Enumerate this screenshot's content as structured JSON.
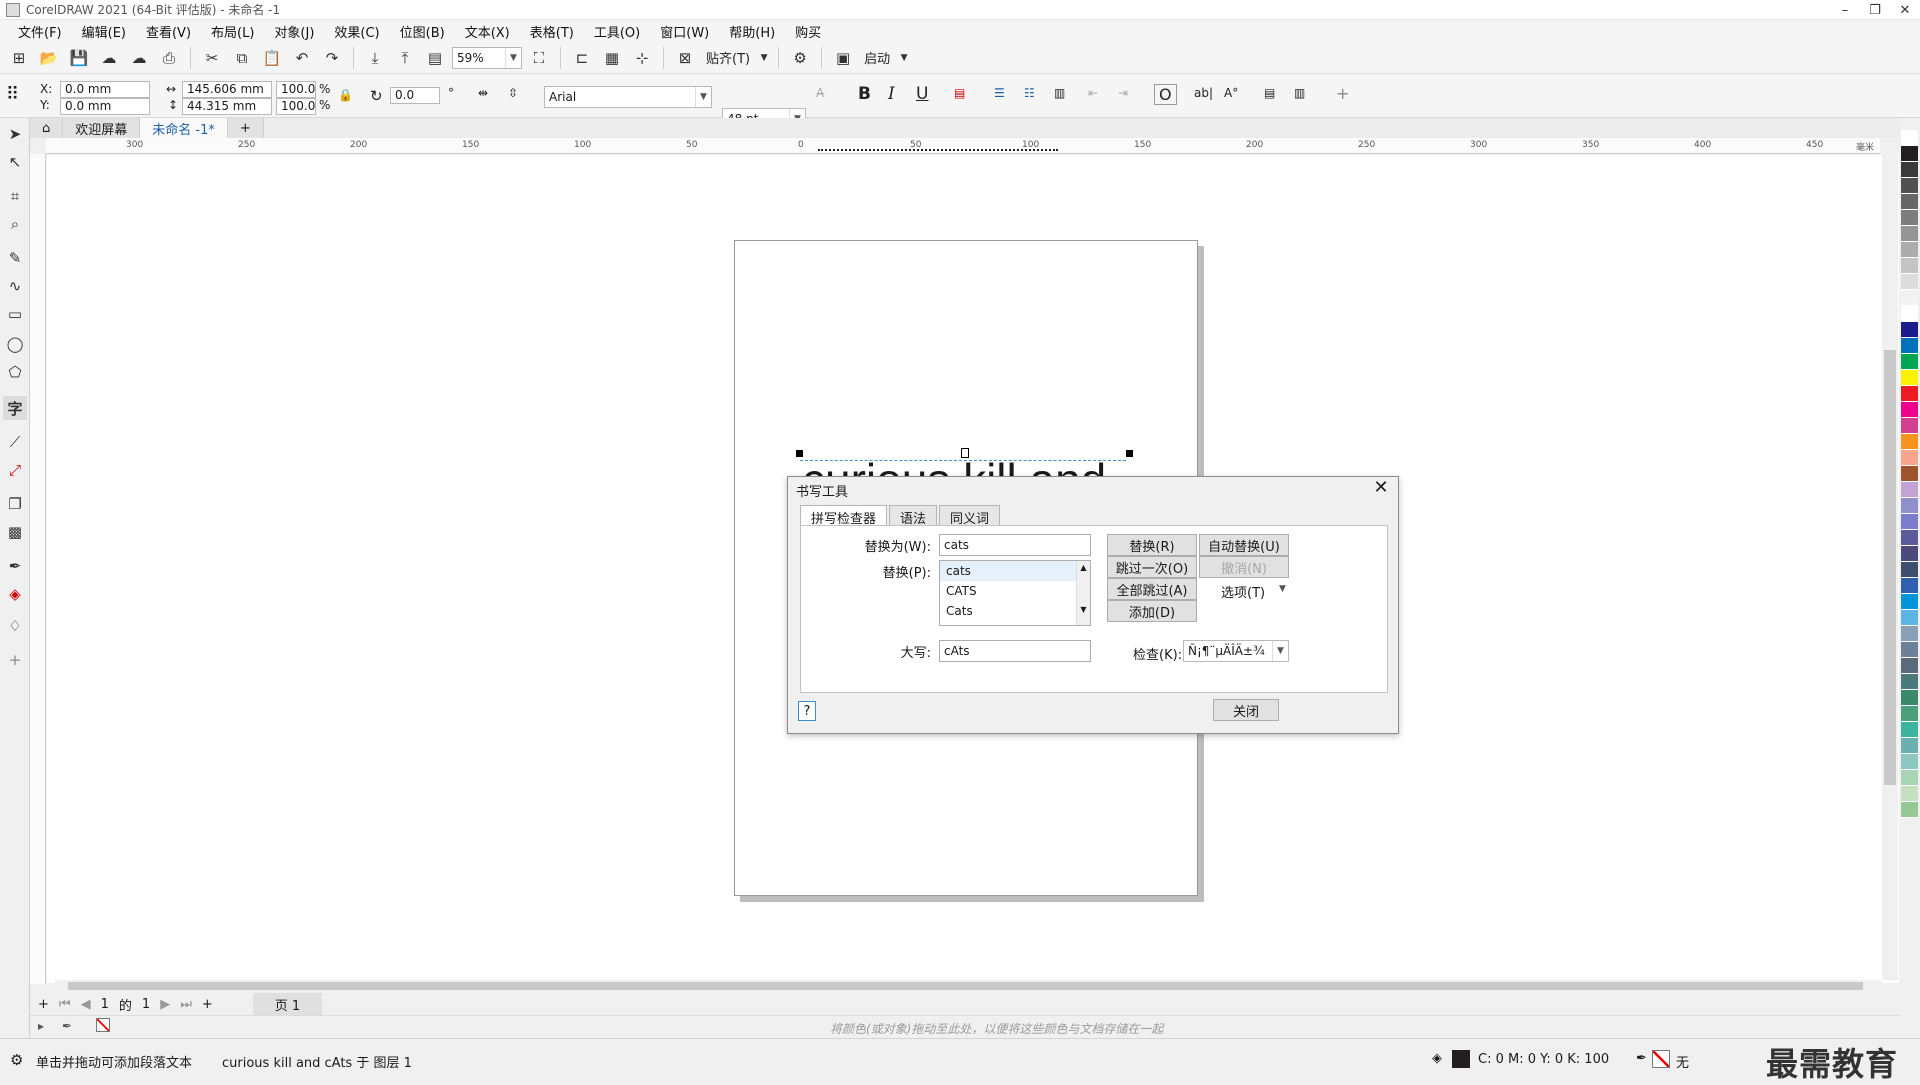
{
  "window": {
    "title": "CorelDRAW 2021 (64-Bit 评估版) - 未命名 -1",
    "controls": [
      "minimize-icon",
      "restore-icon",
      "close-icon"
    ]
  },
  "menubar": {
    "items": [
      "文件(F)",
      "编辑(E)",
      "查看(V)",
      "布局(L)",
      "对象(J)",
      "效果(C)",
      "位图(B)",
      "文本(X)",
      "表格(T)",
      "工具(O)",
      "窗口(W)",
      "帮助(H)",
      "购买"
    ]
  },
  "toolbar1": {
    "zoom": "59%",
    "snap_label": "贴齐(T)",
    "launch_label": "启动"
  },
  "toolbar2": {
    "x_label": "X:",
    "x_value": "0.0 mm",
    "y_label": "Y:",
    "y_value": "0.0 mm",
    "w_value": "145.606 mm",
    "h_value": "44.315 mm",
    "scale_w": "100.0",
    "scale_h": "100.0",
    "pct": "%",
    "rotation": "0.0",
    "degree": "°",
    "font": "Arial",
    "font_size": "48 pt",
    "bold": "B",
    "italic": "I",
    "underline": "U"
  },
  "tabs": {
    "home": "欢迎屏幕",
    "doc": "未命名 -1*",
    "add": "+"
  },
  "rulers": {
    "h_ticks": [
      "300",
      "250",
      "200",
      "150",
      "100",
      "50",
      "0",
      "50",
      "100",
      "150",
      "200",
      "250",
      "300",
      "350",
      "400",
      "450"
    ],
    "unit": "毫米"
  },
  "canvas": {
    "text_object": "curious kill and"
  },
  "dialog": {
    "title": "书写工具",
    "tabs": [
      "拼写检查器",
      "语法",
      "同义词"
    ],
    "replace_with_label": "替换为(W):",
    "replace_with_value": "cats",
    "replace_label": "替换(P):",
    "suggestions": [
      "cats",
      "CATS",
      "Cats"
    ],
    "case_label": "大写:",
    "case_value": "cAts",
    "buttons": {
      "replace": "替换(R)",
      "auto_replace": "自动替换(U)",
      "skip_once": "跳过一次(O)",
      "undo": "撤消(N)",
      "skip_all": "全部跳过(A)",
      "options": "选项(T)",
      "add": "添加(D)",
      "close": "关闭",
      "help": "?"
    },
    "check_label": "检查(K):",
    "check_value": "Ñ¡¶¨µÄÎÄ±¾"
  },
  "pagebar": {
    "current": "1",
    "of": "的",
    "total": "1",
    "page_tab": "页 1"
  },
  "docpalette": {
    "hint": "将颜色(或对象)拖动至此处，以便将这些颜色与文档存储在一起"
  },
  "status": {
    "hint": "单击并拖动可添加段落文本",
    "object_info": "curious kill and cAts 于 图层 1",
    "cmyk": "C: 0 M: 0 Y: 0 K: 100",
    "outline": "无"
  },
  "watermark": "最需教育",
  "palette_colors": [
    "#ffffff",
    "#231f20",
    "#3a3a3a",
    "#505050",
    "#666666",
    "#7d7d7d",
    "#959595",
    "#acacac",
    "#c4c4c4",
    "#dcdcdc",
    "#f2f2f2",
    "#ffffff",
    "#1b1b8c",
    "#0072bc",
    "#00a651",
    "#fff200",
    "#ed1c24",
    "#ec008c",
    "#d23f8e",
    "#f7941d",
    "#f9a58e",
    "#a0522d",
    "#c3a3d3",
    "#8f8fc9",
    "#7b7bd0",
    "#5b5b9b",
    "#4b4b7b",
    "#3f4f6f",
    "#2f5faf",
    "#0095da",
    "#5bb3e6",
    "#88a0b8",
    "#6d8099",
    "#5a6a7a",
    "#4a7a7a",
    "#3a8a6a",
    "#4aa07a",
    "#3cb4a0",
    "#6ab0b0",
    "#8cc8c0",
    "#a6d4b4",
    "#c4e0c0",
    "#96c896"
  ]
}
